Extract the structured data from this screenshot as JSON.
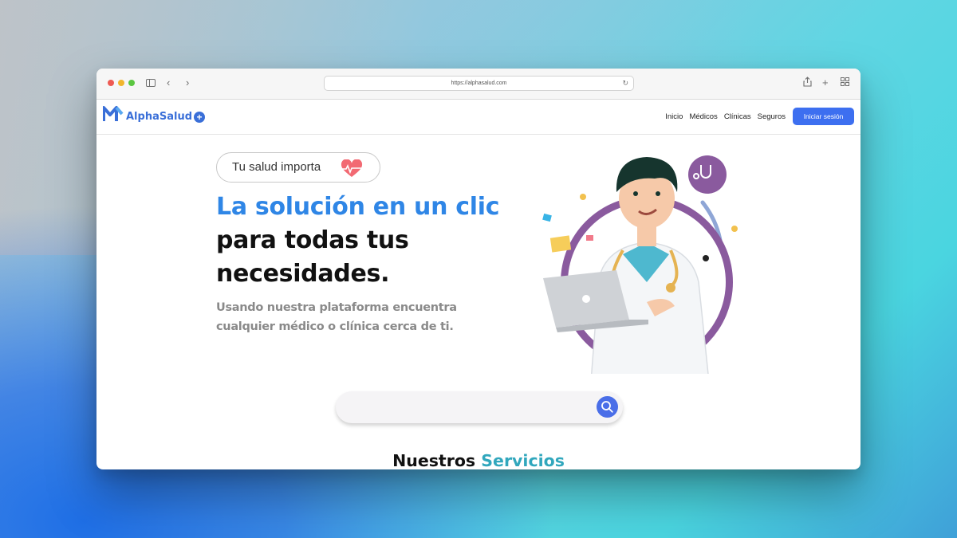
{
  "browser": {
    "url": "https://alphasalud.com",
    "icons": [
      "sidebar-icon",
      "back-icon",
      "forward-icon",
      "reload-icon",
      "share-icon",
      "new-tab-icon",
      "tabs-grid-icon"
    ]
  },
  "nav": {
    "brand": "AlphaSalud",
    "links": [
      "Inicio",
      "Médicos",
      "Clínicas",
      "Seguros"
    ],
    "login_label": "Iniciar sesión"
  },
  "hero": {
    "pill_text": "Tu salud importa",
    "headline_accent": "La solución en un clic",
    "headline_rest": " para todas tus necesidades.",
    "subtext": "Usando nuestra plataforma encuentra cualquier médico o clínica cerca de ti."
  },
  "search": {
    "placeholder": ""
  },
  "services": {
    "title_main": "Nuestros",
    "title_accent": "Servicios"
  },
  "colors": {
    "accent_blue": "#3d6ff0",
    "headline_blue": "#2f86e6",
    "services_teal": "#31a7bd",
    "illustration_purple": "#8a5a9e"
  }
}
